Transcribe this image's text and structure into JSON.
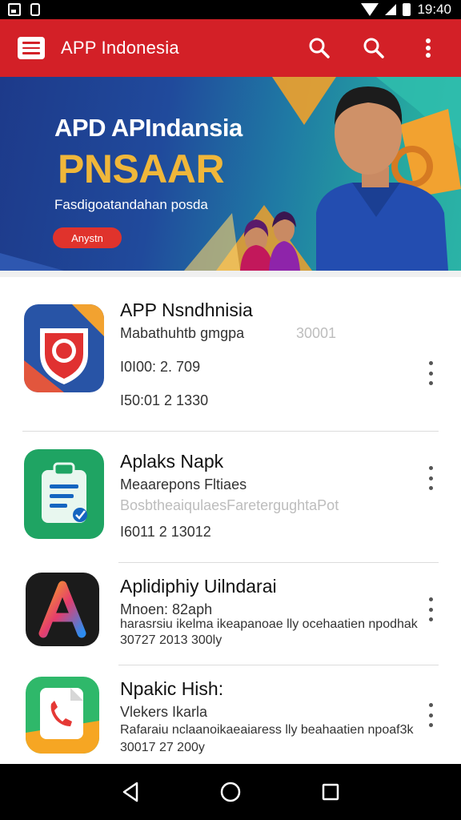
{
  "status_bar": {
    "time": "19:40"
  },
  "app_bar": {
    "title": "APP Indonesia"
  },
  "banner": {
    "title": "APD APIndansia",
    "headline": "PNSAAR",
    "subtitle": "Fasdigoatandahan posda",
    "button_label": "Anystn"
  },
  "apps": [
    {
      "title": "APP Nsndhnisia",
      "line1": "Mabathuhtb gmgpa",
      "line1_faded": "30001",
      "line2": "I0I00: 2. 709",
      "line3": "I50:01 2 1330"
    },
    {
      "title": "Aplaks Napk",
      "line1": "Meaarepons Fltiaes",
      "line2_faded": "BosbtheaiqulaesFaretergughtaPot",
      "line3": "I6011 2 13012"
    },
    {
      "title": "Aplidiphiy Uilndarai",
      "line1": "Mnoen: 82aph",
      "line2": "harasrsiu ikelma ikeapanoae lly ocehaatien npodhak",
      "line3": "30727 2013 300ly"
    },
    {
      "title": "Npakic Hish:",
      "line1": "Vlekers Ikarla",
      "line2": "Rafaraiu nclaanoikaeaiaress lly beahaatien npoaf3k",
      "line3": "30017 27 200y"
    }
  ],
  "colors": {
    "app_bar": "#d32027",
    "banner_accent": "#f0b73a",
    "status_bar": "#000000"
  },
  "icons": {
    "menu": "hamburger-icon",
    "search": "search-icon",
    "more": "more-vert-icon"
  }
}
